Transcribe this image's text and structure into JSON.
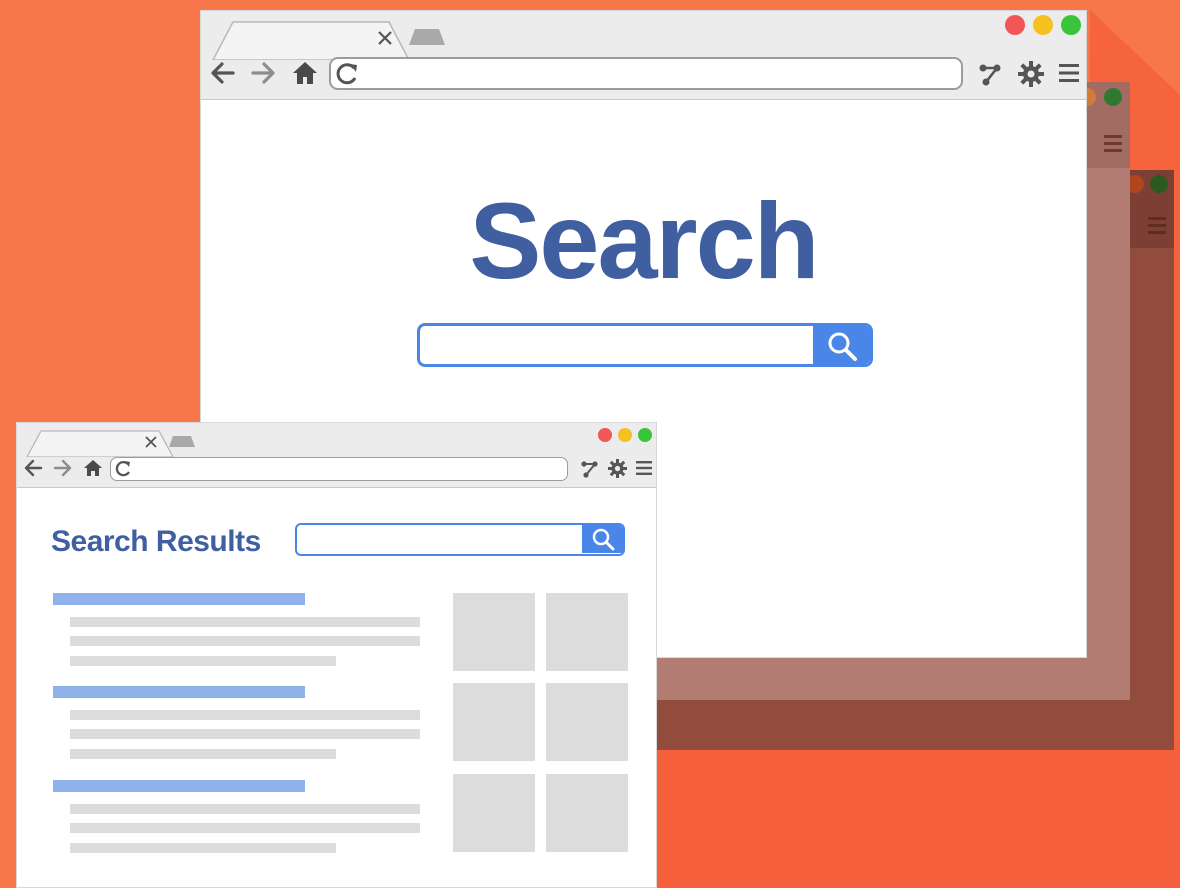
{
  "colors": {
    "background": "#f7774a",
    "accent_blue": "#3f5fa0",
    "search_blue": "#4a86e8",
    "result_link": "#8fb2ea",
    "placeholder": "#dcdcdc",
    "window_back1": "#b27c72",
    "window_back2": "#924c3d",
    "dot_red": "#f25757",
    "dot_yellow": "#f7c021",
    "dot_green": "#3ac43a"
  },
  "main_window": {
    "heading": "Search",
    "search": {
      "value": "",
      "placeholder": ""
    },
    "icons": [
      "back-arrow-icon",
      "forward-arrow-icon",
      "home-icon",
      "reload-icon",
      "extensions-icon",
      "gear-icon",
      "menu-icon",
      "close-tab-icon"
    ]
  },
  "results_window": {
    "heading": "Search Results",
    "search": {
      "value": "",
      "placeholder": ""
    },
    "results": [
      {
        "title_lines": 1,
        "snippet_lines": 3
      },
      {
        "title_lines": 1,
        "snippet_lines": 3
      },
      {
        "title_lines": 1,
        "snippet_lines": 3
      }
    ],
    "thumbnails": 6
  }
}
